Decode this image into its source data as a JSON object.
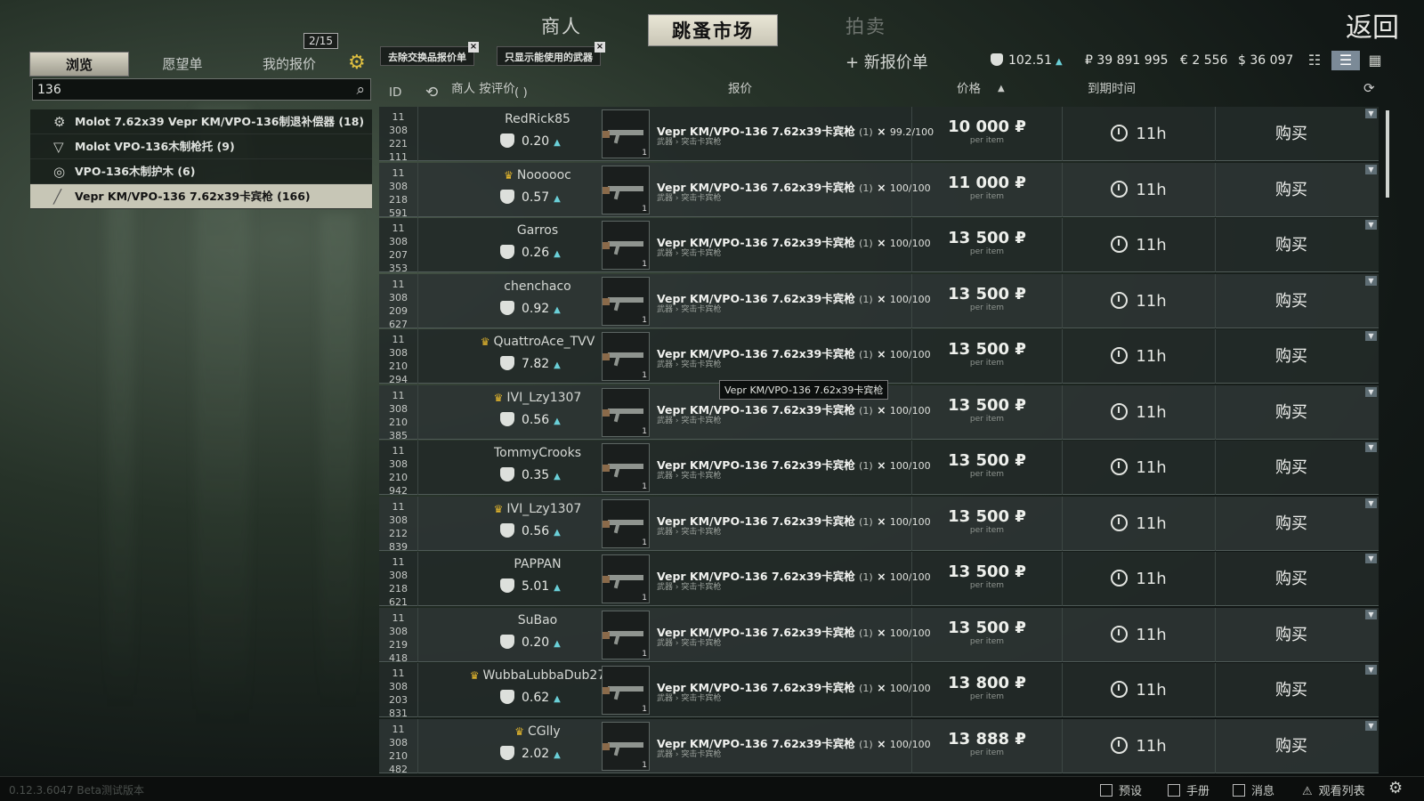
{
  "top_nav": {
    "traders": "商人",
    "flea_market": "跳蚤市场",
    "auction": "拍卖",
    "back": "返回"
  },
  "left_tabs": {
    "browse": "浏览",
    "wishlist": "愿望单",
    "my_offers": "我的报价",
    "offers_count": "2/15"
  },
  "search": {
    "value": "136"
  },
  "categories": [
    {
      "icon": "gear-icon",
      "label": "Molot 7.62x39 Vepr KM/VPO-136制退补偿器 (18)"
    },
    {
      "icon": "triangle-icon",
      "label": "Molot VPO-136木制枪托 (9)"
    },
    {
      "icon": "ring-icon",
      "label": "VPO-136木制护木 (6)"
    },
    {
      "icon": "rifle-icon",
      "label": "Vepr KM/VPO-136 7.62x39卡宾枪 (166)"
    }
  ],
  "filters": {
    "remove_barter": "去除交换品报价单",
    "functional_only": "只显示能使用的武器",
    "new_offer": "+ 新报价单"
  },
  "currency": {
    "rep": "102.51",
    "rub": "₽ 39 891 995",
    "eur": "€ 2 556",
    "usd": "$ 36 097"
  },
  "headers": {
    "id": "ID",
    "seller": "商人 按评价",
    "seller_paren": "(          )",
    "offer": "报价",
    "price": "价格",
    "expires": "到期时间"
  },
  "tooltip": "Vepr KM/VPO-136 7.62x39卡宾枪",
  "item": {
    "name": "Vepr KM/VPO-136 7.62x39卡宾枪",
    "count": "(1)",
    "category": "武器 › 突击卡宾枪",
    "per_item": "per item",
    "buy": "购买",
    "time": "11h",
    "thumb_qty": "1"
  },
  "offers": [
    {
      "id": [
        "11",
        "308",
        "221",
        "111"
      ],
      "seller": "RedRick85",
      "crown": false,
      "rating": "0.20",
      "durability": "99.2/100",
      "price": "10 000"
    },
    {
      "id": [
        "11",
        "308",
        "218",
        "591"
      ],
      "seller": "Noooooc",
      "crown": true,
      "rating": "0.57",
      "durability": "100/100",
      "price": "11 000"
    },
    {
      "id": [
        "11",
        "308",
        "207",
        "353"
      ],
      "seller": "Garros",
      "crown": false,
      "rating": "0.26",
      "durability": "100/100",
      "price": "13 500"
    },
    {
      "id": [
        "11",
        "308",
        "209",
        "627"
      ],
      "seller": "chenchaco",
      "crown": false,
      "rating": "0.92",
      "durability": "100/100",
      "price": "13 500"
    },
    {
      "id": [
        "11",
        "308",
        "210",
        "294"
      ],
      "seller": "QuattroAce_TVV",
      "crown": true,
      "rating": "7.82",
      "durability": "100/100",
      "price": "13 500"
    },
    {
      "id": [
        "11",
        "308",
        "210",
        "385"
      ],
      "seller": "IVI_Lzy1307",
      "crown": true,
      "rating": "0.56",
      "durability": "100/100",
      "price": "13 500"
    },
    {
      "id": [
        "11",
        "308",
        "210",
        "942"
      ],
      "seller": "TommyCrooks",
      "crown": false,
      "rating": "0.35",
      "durability": "100/100",
      "price": "13 500"
    },
    {
      "id": [
        "11",
        "308",
        "212",
        "839"
      ],
      "seller": "IVI_Lzy1307",
      "crown": true,
      "rating": "0.56",
      "durability": "100/100",
      "price": "13 500"
    },
    {
      "id": [
        "11",
        "308",
        "218",
        "621"
      ],
      "seller": "PAPPAN",
      "crown": false,
      "rating": "5.01",
      "durability": "100/100",
      "price": "13 500"
    },
    {
      "id": [
        "11",
        "308",
        "219",
        "418"
      ],
      "seller": "SuBao",
      "crown": false,
      "rating": "0.20",
      "durability": "100/100",
      "price": "13 500"
    },
    {
      "id": [
        "11",
        "308",
        "203",
        "831"
      ],
      "seller": "WubbaLubbaDub27",
      "crown": true,
      "rating": "0.62",
      "durability": "100/100",
      "price": "13 800"
    },
    {
      "id": [
        "11",
        "308",
        "210",
        "482"
      ],
      "seller": "CGlly",
      "crown": true,
      "rating": "2.02",
      "durability": "100/100",
      "price": "13 888"
    }
  ],
  "bottom": {
    "version": "0.12.3.6047 Beta测试版本",
    "presets": "预设",
    "handbook": "手册",
    "messages": "消息",
    "watchlist": "观看列表"
  }
}
